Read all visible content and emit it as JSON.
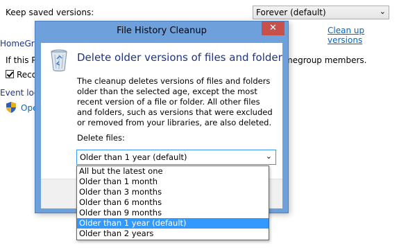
{
  "background": {
    "keep_versions_label": "Keep saved versions:",
    "keep_versions_value": "Forever (default)",
    "clean_up_link": "Clean up versions",
    "homegroup_heading": "HomeGro",
    "homegroup_text_left": "If this PC",
    "homegroup_text_right": "megroup members.",
    "recommend_label": "Reco",
    "event_log_heading": "Event log",
    "open_link": "Ope"
  },
  "dialog": {
    "title": "File History Cleanup",
    "close_glyph": "✕",
    "icon": "recycle-bin-icon",
    "heading": "Delete older versions of files and folders",
    "description": "The cleanup deletes versions of files and folders older than the selected age, except the most recent version of a file or folder. All other files and folders, such as versions that were excluded or removed from your libraries, are also deleted.",
    "delete_files_label": "Delete files:",
    "selected_value": "Older than 1 year (default)",
    "options": [
      "All but the latest one",
      "Older than 1 month",
      "Older than 3 months",
      "Older than 6 months",
      "Older than 9 months",
      "Older than 1 year (default)",
      "Older than 2 years"
    ],
    "highlight_color": "#3399ff"
  }
}
